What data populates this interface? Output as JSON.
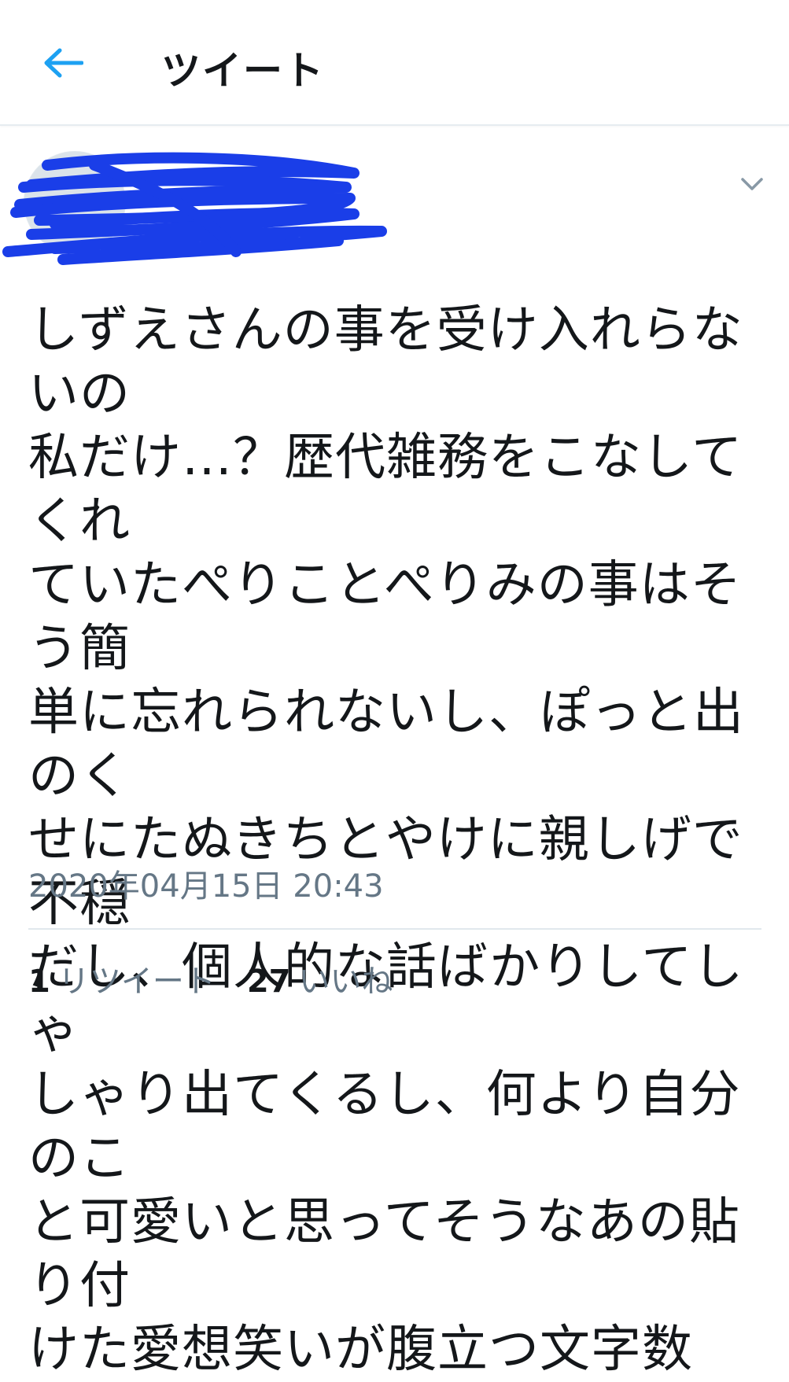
{
  "header": {
    "back_icon": "arrow-left-icon",
    "title": "ツイート"
  },
  "colors": {
    "accent": "#1da1f2",
    "redaction_ink": "#1a3ee8",
    "text_primary": "#14171a",
    "text_secondary": "#657786"
  },
  "author": {
    "display_name": "",
    "handle": "",
    "menu_icon": "chevron-down-icon"
  },
  "tweet": {
    "text": "しずえさんの事を受け入れらないの\n私だけ…？歴代雑務をこなしてくれ\nていたぺりことぺりみの事はそう簡\n単に忘れられないし、ぽっと出のく\nせにたぬきちとやけに親しげで不穏\nだし、個人的な話ばかりしてしゃ\nしゃり出てくるし、何より自分のこ\nと可愛いと思ってそうなあの貼り付\nけた愛想笑いが腹立つ文字数",
    "timestamp": "2020年04月15日 20:43"
  },
  "stats": {
    "retweet_count": "1",
    "retweet_label": "リツイート",
    "like_count": "27",
    "like_label": "いいね"
  }
}
